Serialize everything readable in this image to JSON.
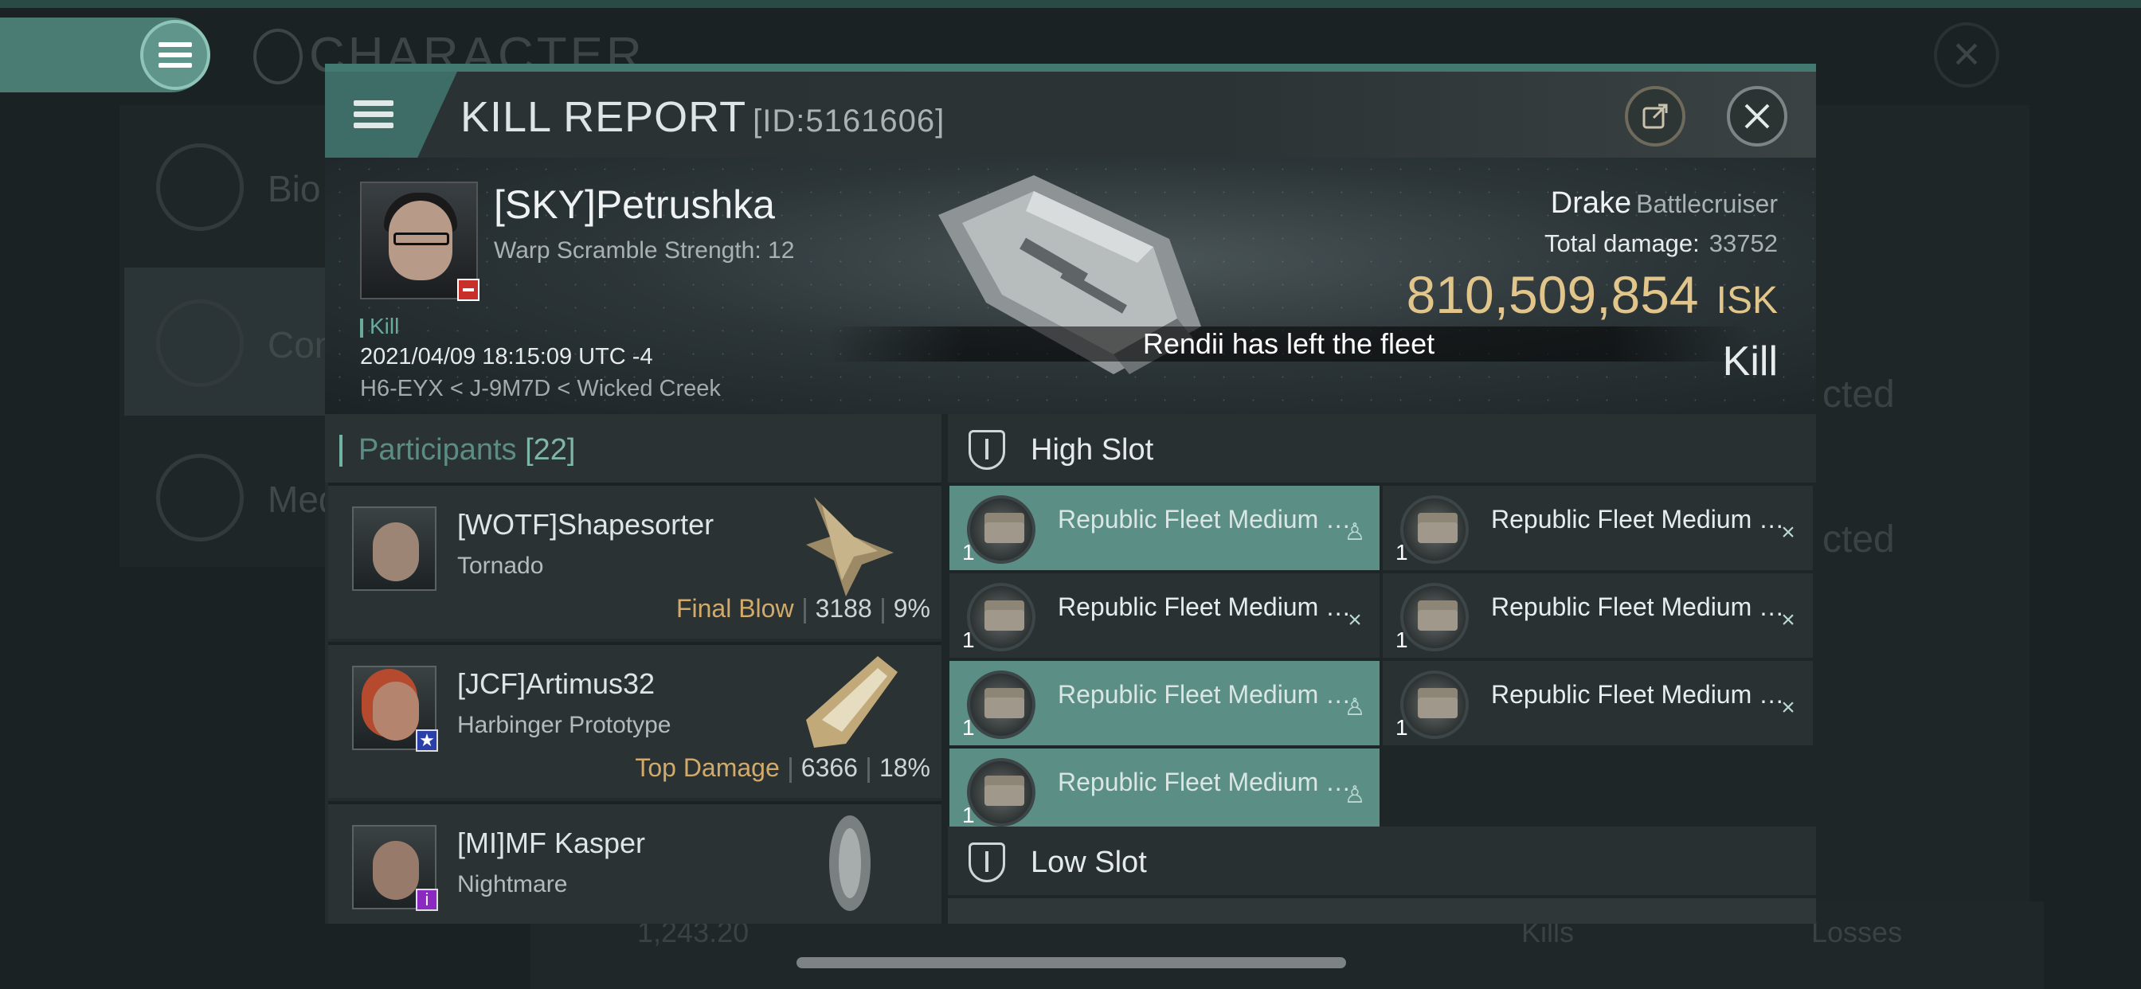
{
  "background": {
    "title": "CHARACTER",
    "left_menu": [
      "Bio",
      "Com",
      "Med"
    ],
    "right_items": [
      "cted",
      "cted"
    ],
    "bottom": {
      "balance": "1,243.20",
      "kills_label": "Kills",
      "losses_label": "Losses"
    }
  },
  "dialog": {
    "title": "KILL REPORT",
    "id": "[ID:5161606]",
    "victim": {
      "name": "[SKY]Petrushka",
      "subtitle": "Warp Scramble Strength: 12",
      "kill_tag": "Kill",
      "datetime": "2021/04/09 18:15:09 UTC -4",
      "location": "H6-EYX < J-9M7D < Wicked Creek",
      "ship_name": "Drake",
      "ship_class": "Battlecruiser",
      "total_damage_label": "Total damage:",
      "total_damage": "33752",
      "isk_value": "810,509,854",
      "isk_unit": "ISK",
      "result": "Kill"
    },
    "toast": "Rendii has left the fleet",
    "participants": {
      "label": "Participants",
      "count": "[22]",
      "items": [
        {
          "name": "[WOTF]Shapesorter",
          "ship": "Tornado",
          "tag": "Final Blow",
          "damage": "3188",
          "percent": "9%",
          "badge": ""
        },
        {
          "name": "[JCF]Artimus32",
          "ship": "Harbinger Prototype",
          "tag": "Top Damage",
          "damage": "6366",
          "percent": "18%",
          "badge": "★"
        },
        {
          "name": "[MI]MF Kasper",
          "ship": "Nightmare",
          "tag": "",
          "damage": "",
          "percent": "",
          "badge": "i"
        }
      ]
    },
    "high_slot": {
      "label": "High Slot",
      "modules": [
        {
          "name": "Republic Fleet Medium Rapi...",
          "qty": "1",
          "state": "dropped"
        },
        {
          "name": "Republic Fleet Medium Rapi...",
          "qty": "1",
          "state": "destroyed"
        },
        {
          "name": "Republic Fleet Medium Rapi...",
          "qty": "1",
          "state": "destroyed"
        },
        {
          "name": "Republic Fleet Medium Rapi...",
          "qty": "1",
          "state": "destroyed"
        },
        {
          "name": "Republic Fleet Medium Rapi...",
          "qty": "1",
          "state": "dropped"
        },
        {
          "name": "Republic Fleet Medium Rapi...",
          "qty": "1",
          "state": "destroyed"
        },
        {
          "name": "Republic Fleet Medium Rapi...",
          "qty": "1",
          "state": "dropped"
        }
      ]
    },
    "low_slot": {
      "label": "Low Slot"
    }
  },
  "colors": {
    "accent": "#427a71",
    "isk": "#e2c58a",
    "final_blow": "#d2aa6a",
    "dropped_module": "#5b8f86"
  },
  "icons": [
    "menu-icon",
    "share-icon",
    "close-icon",
    "slot-icon",
    "security-status-icon"
  ]
}
